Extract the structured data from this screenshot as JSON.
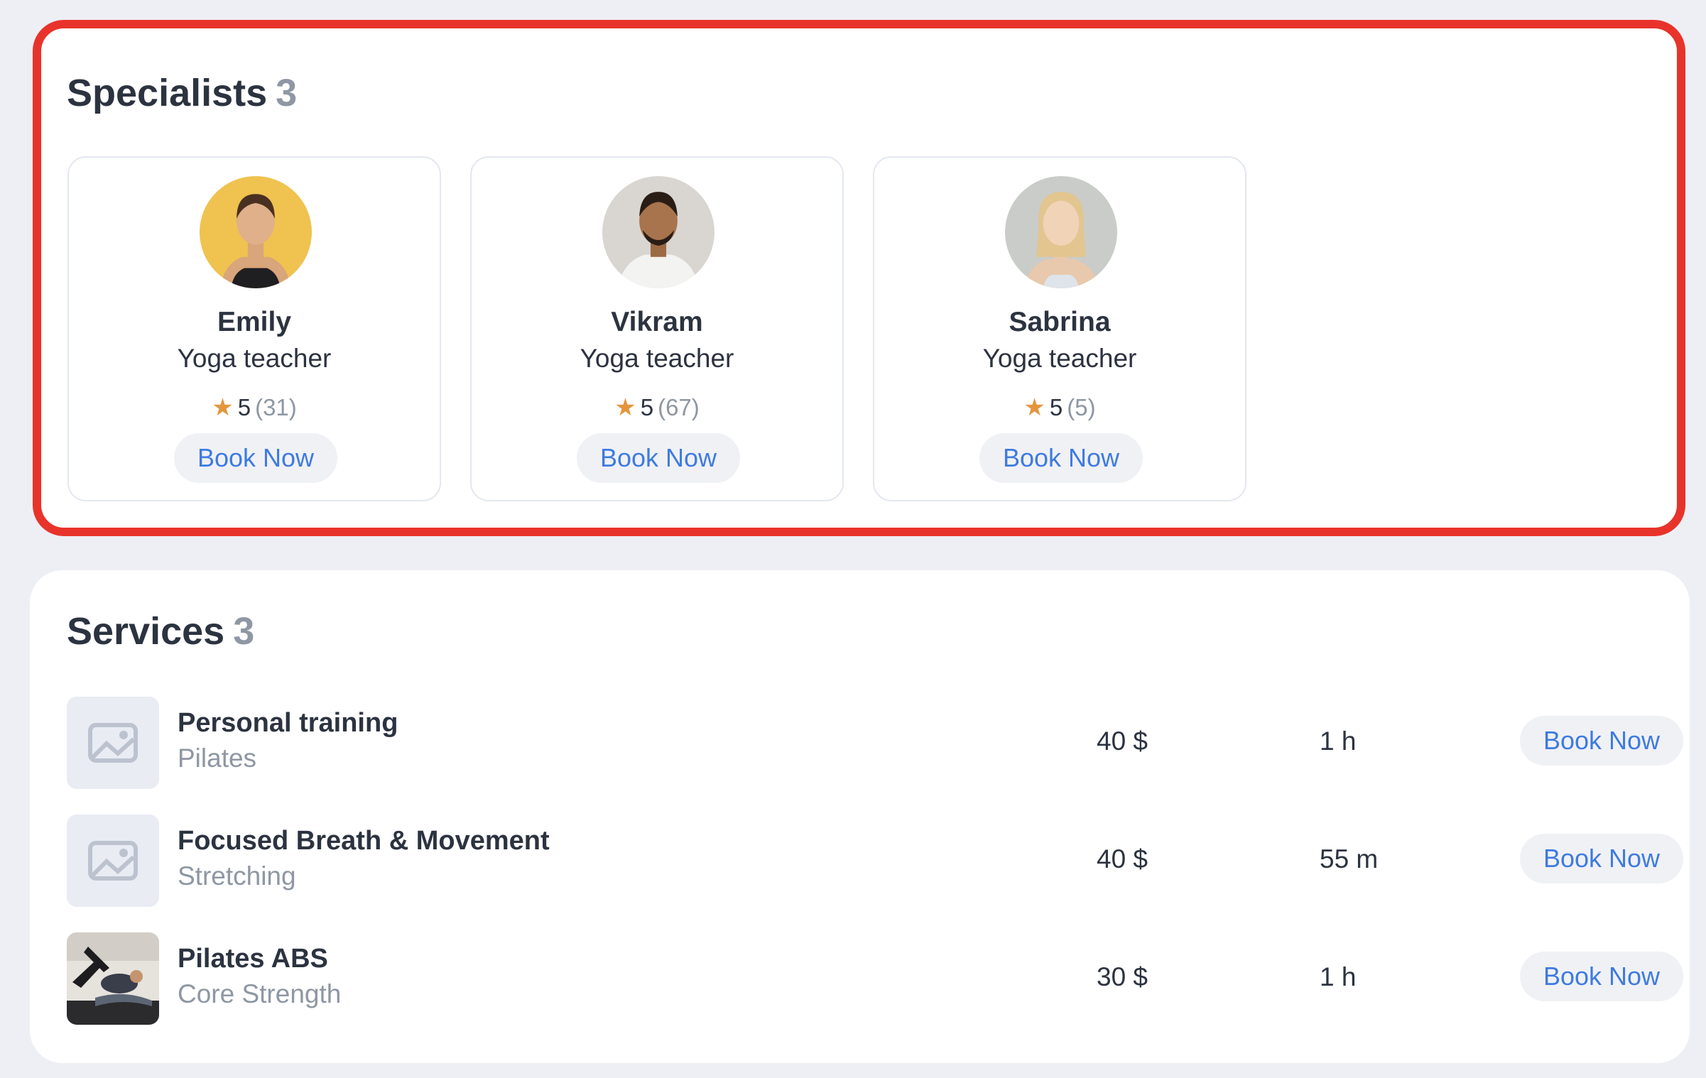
{
  "specialists": {
    "title": "Specialists",
    "count": "3",
    "highlight_color": "#e8332b",
    "items": [
      {
        "name": "Emily",
        "role": "Yoga teacher",
        "rating": "5",
        "reviews": "(31)",
        "cta": "Book Now",
        "avatar_bg": "#f0c24f"
      },
      {
        "name": "Vikram",
        "role": "Yoga teacher",
        "rating": "5",
        "reviews": "(67)",
        "cta": "Book Now",
        "avatar_bg": "#d9d6d1"
      },
      {
        "name": "Sabrina",
        "role": "Yoga teacher",
        "rating": "5",
        "reviews": "(5)",
        "cta": "Book Now",
        "avatar_bg": "#c9ccc9"
      }
    ]
  },
  "services": {
    "title": "Services",
    "count": "3",
    "items": [
      {
        "name": "Personal training",
        "category": "Pilates",
        "price": "40 $",
        "duration": "1 h",
        "cta": "Book Now",
        "thumb": "placeholder-image-icon"
      },
      {
        "name": "Focused Breath & Movement",
        "category": "Stretching",
        "price": "40 $",
        "duration": "55 m",
        "cta": "Book Now",
        "thumb": "placeholder-image-icon"
      },
      {
        "name": "Pilates ABS",
        "category": "Core Strength",
        "price": "30 $",
        "duration": "1 h",
        "cta": "Book Now",
        "thumb": "pilates-photo"
      }
    ]
  },
  "colors": {
    "accent": "#3e7be0",
    "star": "#e3963e",
    "muted_text": "#8e97a3",
    "text": "#2c3340"
  }
}
